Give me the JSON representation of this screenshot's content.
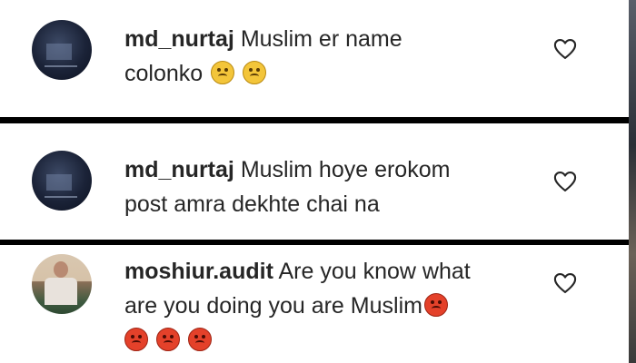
{
  "comments": [
    {
      "username": "md_nurtaj",
      "line1": "Muslim er name",
      "line2": "colonko",
      "emojis": [
        "angry-face",
        "angry-face"
      ],
      "like_icon": "heart-outline-icon"
    },
    {
      "username": "md_nurtaj",
      "line1": "Muslim hoye erokom",
      "line2": "post amra dekhte chai na",
      "emojis": [],
      "like_icon": "heart-outline-icon"
    },
    {
      "username": "moshiur.audit",
      "line1": "Are you know what",
      "line2": "are you doing you are Muslim",
      "emojis": [
        "pouting-face",
        "pouting-face",
        "pouting-face",
        "pouting-face"
      ],
      "like_icon": "heart-outline-icon"
    }
  ],
  "colors": {
    "text": "#262626",
    "separator": "#000000",
    "angry_emoji": "#f3c53a",
    "pouting_emoji": "#e4412a"
  }
}
